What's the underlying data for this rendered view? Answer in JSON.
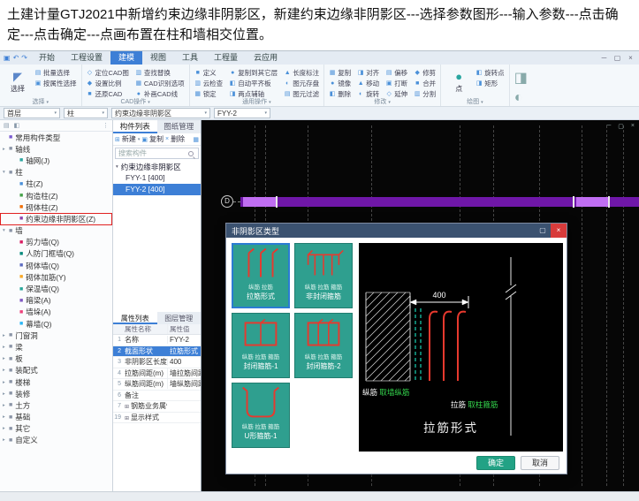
{
  "note": {
    "text": "土建计量GTJ2021中新增约束边缘非阴影区，新建约束边缘非阴影区---选择参数图形---输入参数---点击确定---点击确定---点画布置在柱和墙相交位置。"
  },
  "icons": {
    "logo": "▣",
    "undo": "↶",
    "redo": "↷",
    "chevron": "▾",
    "min": "─",
    "max": "▢",
    "close": "×",
    "select": "◤",
    "point": "●",
    "menu": "▤",
    "panel": "◧",
    "dots": "⋮",
    "group_open": "▾",
    "new": "⊞",
    "copy": "▣",
    "del": "×",
    "layer": "▦",
    "tools1": "◨",
    "tools2": "◐"
  },
  "ribbon": {
    "tabs": [
      "开始",
      "工程设置",
      "建模",
      "视图",
      "工具",
      "工程量",
      "云应用"
    ],
    "active_tab": "建模",
    "groups": [
      {
        "label": "选择",
        "big": "选择",
        "items": [
          "批量选择",
          "按属性选择"
        ]
      },
      {
        "label": "CAD操作",
        "items": [
          "定位CAD图",
          "设置比例",
          "还原CAD",
          "查找替换",
          "CAD识别选项",
          "补画CAD线"
        ]
      },
      {
        "label": "通用操作",
        "items": [
          "定义",
          "云检查",
          "锁定",
          "复制到其它层",
          "自动平齐板",
          "两点辅轴",
          "长度标注",
          "图元存盘",
          "图元过滤"
        ]
      },
      {
        "label": "修改",
        "items": [
          "复制",
          "镜像",
          "删除",
          "对齐",
          "移动",
          "旋转",
          "偏移",
          "打断",
          "延伸",
          "修剪",
          "合并",
          "分割"
        ]
      },
      {
        "label": "绘图",
        "big": "点",
        "items": [
          "旋转点",
          "矩形"
        ]
      }
    ]
  },
  "context": {
    "level": "首层",
    "category": "柱",
    "type": "约束边缘非阴影区",
    "name": "FYY-2"
  },
  "nav": {
    "items": [
      {
        "label": "常用构件类型",
        "level": 0,
        "icon": "#7a5bd0",
        "exp": ""
      },
      {
        "label": "轴线",
        "level": 0,
        "icon": "#8a94a6",
        "exp": "▸"
      },
      {
        "label": "轴网(J)",
        "level": 1,
        "icon": "#2aa6a0"
      },
      {
        "label": "柱",
        "level": 0,
        "icon": "#8a94a6",
        "exp": "▾"
      },
      {
        "label": "柱(Z)",
        "level": 1,
        "icon": "#4a90d9"
      },
      {
        "label": "构造柱(Z)",
        "level": 1,
        "icon": "#43a047"
      },
      {
        "label": "砌体柱(Z)",
        "level": 1,
        "icon": "#ef6c00"
      },
      {
        "label": "约束边缘非阴影区(Z)",
        "level": 1,
        "icon": "#8e44ad",
        "highlight": true
      },
      {
        "label": "墙",
        "level": 0,
        "icon": "#8a94a6",
        "exp": "▾"
      },
      {
        "label": "剪力墙(Q)",
        "level": 1,
        "icon": "#d81b60"
      },
      {
        "label": "人防门框墙(Q)",
        "level": 1,
        "icon": "#00897b"
      },
      {
        "label": "砌体墙(Q)",
        "level": 1,
        "icon": "#5c6bc0"
      },
      {
        "label": "砌体加筋(Y)",
        "level": 1,
        "icon": "#f9a825"
      },
      {
        "label": "保温墙(Q)",
        "level": 1,
        "icon": "#26a69a"
      },
      {
        "label": "暗梁(A)",
        "level": 1,
        "icon": "#7e57c2"
      },
      {
        "label": "墙垛(A)",
        "level": 1,
        "icon": "#ec407a"
      },
      {
        "label": "幕墙(Q)",
        "level": 1,
        "icon": "#29b6f6"
      },
      {
        "label": "门窗洞",
        "level": 0,
        "icon": "#8a94a6",
        "exp": "▸"
      },
      {
        "label": "梁",
        "level": 0,
        "icon": "#8a94a6",
        "exp": "▸"
      },
      {
        "label": "板",
        "level": 0,
        "icon": "#8a94a6",
        "exp": "▸"
      },
      {
        "label": "装配式",
        "level": 0,
        "icon": "#8a94a6",
        "exp": "▸"
      },
      {
        "label": "楼梯",
        "level": 0,
        "icon": "#8a94a6",
        "exp": "▸"
      },
      {
        "label": "装修",
        "level": 0,
        "icon": "#8a94a6",
        "exp": "▸"
      },
      {
        "label": "土方",
        "level": 0,
        "icon": "#8a94a6",
        "exp": "▸"
      },
      {
        "label": "基础",
        "level": 0,
        "icon": "#8a94a6",
        "exp": "▸"
      },
      {
        "label": "其它",
        "level": 0,
        "icon": "#8a94a6",
        "exp": "▸"
      },
      {
        "label": "自定义",
        "level": 0,
        "icon": "#8a94a6",
        "exp": "▸"
      }
    ]
  },
  "panel": {
    "tabs": [
      "构件列表",
      "图纸管理"
    ],
    "toolbar": [
      "新建",
      "复制",
      "删除"
    ],
    "search_placeholder": "搜索构件",
    "group": "约束边缘非阴影区",
    "items": [
      {
        "name": "FYY-1 [400]"
      },
      {
        "name": "FYY-2 [400]",
        "selected": true
      }
    ]
  },
  "properties": {
    "tabs": [
      "属性列表",
      "图层管理"
    ],
    "header": {
      "name": "属性名称",
      "value": "属性值"
    },
    "rows": [
      {
        "no": "1",
        "name": "名称",
        "value": "FYY-2"
      },
      {
        "no": "2",
        "name": "截面形状",
        "value": "拉筋形式",
        "selected": true
      },
      {
        "no": "3",
        "name": "非阴影区长度",
        "value": "400"
      },
      {
        "no": "4",
        "name": "拉筋间距(m)",
        "value": "墙拉筋间距"
      },
      {
        "no": "5",
        "name": "纵筋间距(m)",
        "value": "墙纵筋间距"
      },
      {
        "no": "6",
        "name": "备注",
        "value": ""
      },
      {
        "no": "7",
        "name": "钢筋业务属性",
        "value": "",
        "expandable": true
      },
      {
        "no": "19",
        "name": "显示样式",
        "value": "",
        "expandable": true
      }
    ]
  },
  "canvas": {
    "axis_label": "D"
  },
  "dialog": {
    "title": "非阴影区类型",
    "cards": [
      {
        "name": "拉筋形式",
        "labels": "纵筋  拉筋",
        "shape": "tie",
        "selected": true
      },
      {
        "name": "非封闭箍筋",
        "labels": "纵筋 拉筋 箍筋",
        "shape": "open"
      },
      {
        "name": "封闭箍筋-1",
        "labels": "纵筋 拉筋 箍筋",
        "shape": "closed1"
      },
      {
        "name": "封闭箍筋-2",
        "labels": "纵筋 拉筋 箍筋",
        "shape": "closed2"
      },
      {
        "name": "U形箍筋-1",
        "labels": "纵筋 拉筋 箍筋",
        "shape": "u"
      }
    ],
    "preview": {
      "dim": "400",
      "legend1_label": "纵筋",
      "legend1_value": "取墙纵筋",
      "legend2_label": "拉筋",
      "legend2_value": "取柱箍筋",
      "caption": "拉筋形式"
    },
    "buttons": {
      "ok": "确定",
      "cancel": "取消"
    }
  },
  "colors": {
    "accent_teal": "#2f9f8f",
    "selection_blue": "#3d7fd6",
    "wall_dark": "#6f17a8",
    "wall_light": "#c06ef2",
    "rebar_red": "#e8392e",
    "highlight_red": "#e02020"
  }
}
